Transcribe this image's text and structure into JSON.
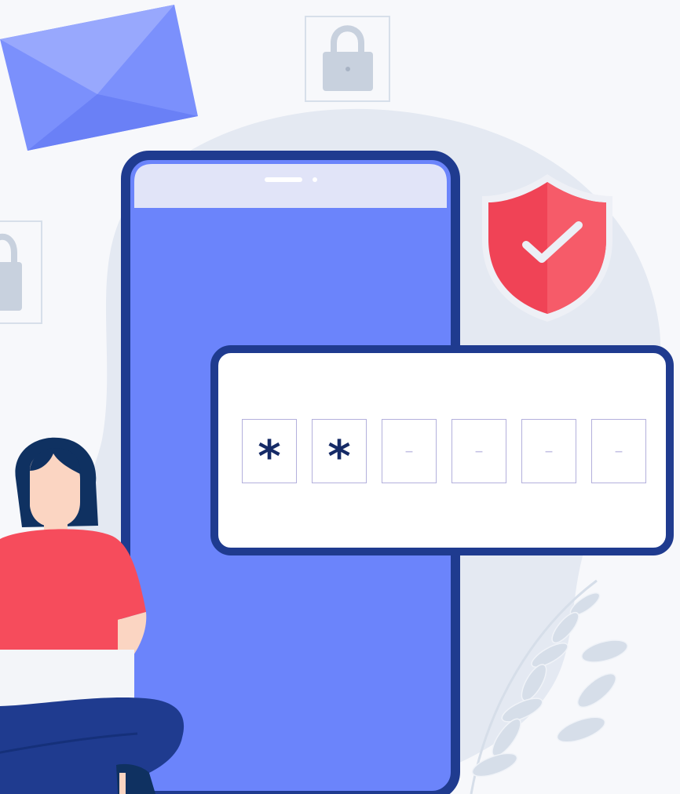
{
  "otp": {
    "digits": [
      "*",
      "*",
      "–",
      "–",
      "–",
      "–"
    ],
    "filled_count": 2,
    "total_count": 6
  },
  "colors": {
    "background": "#f7f8fb",
    "blob": "#e4e9f2",
    "phone_body": "#6b84fb",
    "phone_frame": "#1f3b8f",
    "phone_header": "#e1e4f8",
    "shield": "#f04356",
    "envelope": "#7b90fc",
    "shirt": "#f64c5c",
    "hair": "#0f3161",
    "skin": "#fbd5c2"
  },
  "icons": [
    "envelope-icon",
    "padlock-icon",
    "shield-check-icon",
    "plant-decoration"
  ]
}
